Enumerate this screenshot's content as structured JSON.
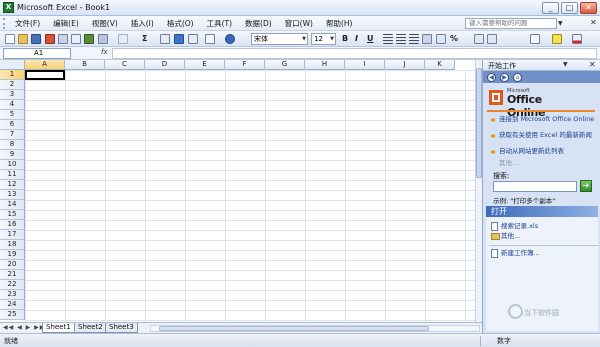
{
  "window": {
    "title": "Microsoft Excel - Book1",
    "app_icon_glyph": "X"
  },
  "window_controls": {
    "minimize": "_",
    "maximize": "□",
    "close": "✕"
  },
  "menubar": {
    "items": [
      "文件(F)",
      "编辑(E)",
      "视图(V)",
      "插入(I)",
      "格式(O)",
      "工具(T)",
      "数据(D)",
      "窗口(W)",
      "帮助(H)"
    ],
    "help_placeholder": "键入需要帮助的问题",
    "doc_close": "✕"
  },
  "toolbar": {
    "font_name": "宋体",
    "font_size": "12",
    "bold": "B",
    "italic": "I",
    "underline": "U",
    "sum": "Σ",
    "percent": "%",
    "icons": [
      "new-icon",
      "open-icon",
      "save-icon",
      "permission-icon",
      "print-icon",
      "print-preview-icon",
      "spelling-icon",
      "cut-icon",
      "copy-icon",
      "paste-icon",
      "undo-icon",
      "autosum-icon",
      "sort-icon",
      "chart-icon",
      "drawing-icon",
      "zoom-icon",
      "help-icon",
      "align-left-icon",
      "center-icon",
      "align-right-icon",
      "merge-icon",
      "currency-icon",
      "borders-icon",
      "fill-color-icon",
      "font-color-icon"
    ]
  },
  "formulabar": {
    "name_box": "A1",
    "fx": "fx",
    "formula": ""
  },
  "sheet": {
    "columns": [
      "A",
      "B",
      "C",
      "D",
      "E",
      "F",
      "G",
      "H",
      "I",
      "J",
      "K"
    ],
    "rows": [
      "1",
      "2",
      "3",
      "4",
      "5",
      "6",
      "7",
      "8",
      "9",
      "10",
      "11",
      "12",
      "13",
      "14",
      "15",
      "16",
      "17",
      "18",
      "19",
      "20",
      "21",
      "22",
      "23",
      "24",
      "25"
    ],
    "active_cell": "A1"
  },
  "sheet_tabs": {
    "nav": "◀◀ ◀ ▶ ▶▶",
    "tabs": [
      "Sheet1",
      "Sheet2",
      "Sheet3"
    ],
    "active": "Sheet1"
  },
  "statusbar": {
    "left": "就绪",
    "right": "数字"
  },
  "taskpane": {
    "title": "开始工作",
    "close": "✕",
    "dropdown": "▼",
    "nav": [
      "◀",
      "▶",
      "⌂"
    ],
    "logo_small": "Microsoft",
    "logo_big": "Office Online",
    "links": [
      "连接到 Microsoft Office Online",
      "获取有关使用 Excel 的最新新闻",
      "自动从网站更新此列表"
    ],
    "more": "其他...",
    "search_label": "搜索:",
    "search_go": "➔",
    "example": "示例:  \"打印多个副本\"",
    "open_header": "打开",
    "open_items": [
      "搜索记录.xls",
      "其他..."
    ],
    "new_workbook": "新建工作簿...",
    "colors": {
      "accent": "#e88a2c",
      "header_blue": "#3d6bbd",
      "pane_bg": "#d7e3f5"
    }
  },
  "watermark": {
    "text": "当下软件园"
  }
}
